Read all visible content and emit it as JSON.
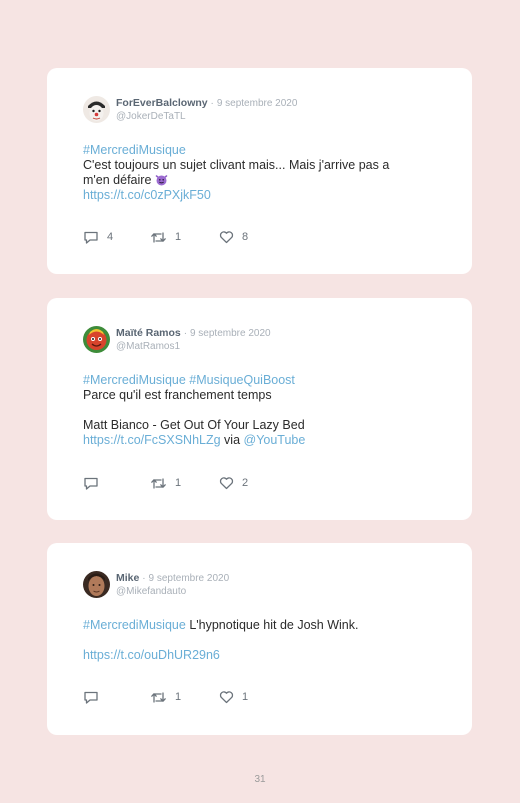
{
  "tweets": [
    {
      "author": "ForEverBalclowny",
      "date": "9 septembre 2020",
      "handle": "@JokerDeTaTL",
      "lines": {
        "hashtags": "#MercrediMusique",
        "text1": "C'est toujours un sujet clivant mais... Mais j'arrive pas a",
        "text2": "m'en défaire",
        "link": "https://t.co/c0zPXjkF50"
      },
      "replies": "4",
      "retweets": "1",
      "likes": "8"
    },
    {
      "author": "Maïté Ramos",
      "date": "9 septembre 2020",
      "handle": "@MatRamos1",
      "lines": {
        "hashtags": "#MercrediMusique #MusiqueQuiBoost",
        "text1": "Parce qu'il est franchement temps",
        "text2": "Matt Bianco - Get Out Of Your Lazy Bed",
        "link": "https://t.co/FcSXSNhLZg",
        "via": "via",
        "mention": "@YouTube"
      },
      "replies": "",
      "retweets": "1",
      "likes": "2"
    },
    {
      "author": "Mike",
      "date": "9 septembre 2020",
      "handle": "@Mikefandauto",
      "lines": {
        "hashtags": "#MercrediMusique",
        "text1": "L'hypnotique hit de Josh Wink.",
        "link": "https://t.co/ouDhUR29n6"
      },
      "replies": "",
      "retweets": "1",
      "likes": "1"
    }
  ],
  "separator": "·",
  "icons": {
    "reply": "reply-icon",
    "retweet": "retweet-icon",
    "like": "heart-icon",
    "emoji": "smiling-imp-emoji"
  },
  "colors": {
    "background": "#f6e4e3",
    "card": "#ffffff",
    "link": "#6aaed6",
    "name": "#5a6673",
    "muted": "#a9b0b8"
  },
  "page_number": "31"
}
